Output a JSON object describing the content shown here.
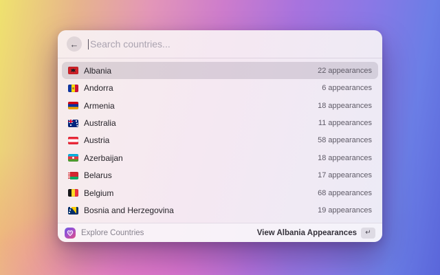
{
  "window": {
    "search": {
      "back_icon": "←",
      "placeholder": "Search countries...",
      "value": ""
    },
    "list": {
      "rows": [
        {
          "flag": "al",
          "country": "Albania",
          "appearances": "22 appearances",
          "selected": true
        },
        {
          "flag": "ad",
          "country": "Andorra",
          "appearances": "6 appearances",
          "selected": false
        },
        {
          "flag": "am",
          "country": "Armenia",
          "appearances": "18 appearances",
          "selected": false
        },
        {
          "flag": "au",
          "country": "Australia",
          "appearances": "11 appearances",
          "selected": false
        },
        {
          "flag": "at",
          "country": "Austria",
          "appearances": "58 appearances",
          "selected": false
        },
        {
          "flag": "az",
          "country": "Azerbaijan",
          "appearances": "18 appearances",
          "selected": false
        },
        {
          "flag": "by",
          "country": "Belarus",
          "appearances": "17 appearances",
          "selected": false
        },
        {
          "flag": "be",
          "country": "Belgium",
          "appearances": "68 appearances",
          "selected": false
        },
        {
          "flag": "ba",
          "country": "Bosnia and Herzegovina",
          "appearances": "19 appearances",
          "selected": false
        }
      ]
    },
    "footer": {
      "app_icon": "heart-icon",
      "app_name": "Explore Countries",
      "action_label": "View Albania Appearances",
      "enter_key_glyph": "↵"
    }
  },
  "colors": {
    "selection_bg": "rgba(80,66,92,0.16)",
    "app_icon_gradient": [
      "#6c59e0",
      "#a54ecb",
      "#e04f80"
    ],
    "desktop_gradient": [
      "#efe26e",
      "#e396b8",
      "#cd7ccc",
      "#a873de",
      "#6b7ee6",
      "#5a66da"
    ]
  }
}
